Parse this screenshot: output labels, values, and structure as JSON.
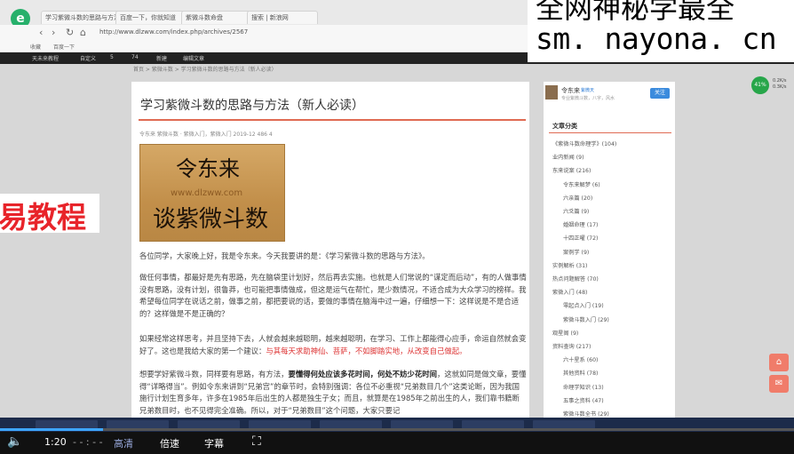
{
  "browser": {
    "tabs": [
      "学习紫微斗数的思路与方法（新人必读）",
      "百度一下，你就知道",
      "紫微斗数命盘",
      "搜索 | 新浪网"
    ],
    "url": "http://www.dlzww.com/index.php/archives/2567",
    "bookmarks": [
      "收藏",
      "百度一下"
    ],
    "nav": {
      "back": "‹",
      "forward": "›",
      "reload": "↻",
      "home": "⌂"
    }
  },
  "adminbar": {
    "items": [
      "天未来教程",
      "自定义",
      "5",
      "74",
      "新建",
      "编辑文章"
    ]
  },
  "watermark": {
    "text": "sm. nayona. cn",
    "top_text": "全网神秘学最全"
  },
  "left_overlay": {
    "text": "易教程"
  },
  "breadcrumb": "首页 > 紫微斗数 > 学习紫微斗数的思路与方法（新人必读）",
  "article": {
    "title": "学习紫微斗数的思路与方法（新人必读）",
    "meta": "令东来   紫微斗数 · 紫微入门，紫微入门   2019-12   486   4",
    "hero": {
      "line1": "令东来",
      "url": "www.dlzww.com",
      "line2": "谈紫微斗数"
    },
    "p1": "各位同学，大家晚上好，我是令东来。今天我要讲的是：《学习紫微斗数的思路与方法》。",
    "p2": "做任何事情，都最好是先有思路，先在脑袋里计划好，然后再去实施。也就是人们常说的“谋定而后动”，有的人做事情没有思路，没有计划，很鲁莽，也可能把事情做成，但这是运气在帮忙，是少数情况，不适合成为大众学习的榜样。我希望每位同学在说话之前，做事之前，都把要说的话，要做的事情在脑海中过一遍，仔细想一下：这样说是不是合适的？这样做是不是正确的？",
    "p3_a": "如果经常这样思考，并且坚持下去，人就会越来越聪明，越来越聪明，在学习、工作上都能得心应手，命运自然就会变好了。这也是我给大家的第一个建议：",
    "p3_red": "与其每天求助神仙、菩萨，不如脚踏实地，从改变自己做起。",
    "p4_a": "想要学好紫微斗数，同样要有思路，有方法，",
    "p4_bold": "要懂得何处应该多花时间，何处不妨少花时间",
    "p4_b": "，这就如同是做文章，要懂得“详略得当”。例如令东来讲到“兄弟宫”的章节时，会特别强调：各位不必重视“兄弟数目几个”这类论断，因为我国施行计划生育多年，许多在1985年后出生的人都是独生子女；而且，就算是在1985年之前出生的人，我们靠书籍断兄弟数目时，也不见得完全准确。所以，对于“兄弟数目”这个问题，大家只要记"
  },
  "sidebar": {
    "author": {
      "name": "令东来",
      "tag": "紫微天",
      "desc": "专业紫微斗数，八字，风水"
    },
    "follow_label": "关注",
    "categories_title": "文章分类",
    "categories": [
      {
        "label": "《紫微斗数命理学》(104)",
        "level": 0
      },
      {
        "label": "业内新闻 (9)",
        "level": 0
      },
      {
        "label": "东来说案 (216)",
        "level": 0
      },
      {
        "label": "令东来解梦 (6)",
        "level": 1
      },
      {
        "label": "六亲篇 (20)",
        "level": 1
      },
      {
        "label": "六爻篇 (9)",
        "level": 1
      },
      {
        "label": "婚姻命理 (17)",
        "level": 1
      },
      {
        "label": "十四正曜 (72)",
        "level": 1
      },
      {
        "label": "案例学 (9)",
        "level": 1
      },
      {
        "label": "实例解析 (31)",
        "level": 0
      },
      {
        "label": "热点问题解答 (70)",
        "level": 0
      },
      {
        "label": "紫微入门 (48)",
        "level": 0
      },
      {
        "label": "零起点入门 (19)",
        "level": 1
      },
      {
        "label": "紫微斗数入门 (29)",
        "level": 1
      },
      {
        "label": "观星阁 (9)",
        "level": 0
      },
      {
        "label": "资料查询 (217)",
        "level": 0
      },
      {
        "label": "六十星系 (60)",
        "level": 1
      },
      {
        "label": "其他资料 (78)",
        "level": 1
      },
      {
        "label": "命理学知识 (13)",
        "level": 1
      },
      {
        "label": "五事之资料 (47)",
        "level": 1
      },
      {
        "label": "紫微斗数全书 (29)",
        "level": 1
      }
    ]
  },
  "widgets": {
    "speed_percent": "41%",
    "speed_up": "0.2K/s",
    "speed_down": "0.3K/s",
    "home_icon": "⌂",
    "chat_icon": "✉"
  },
  "player": {
    "time": "1:20",
    "duration": "- - : - -",
    "quality": "高清",
    "speed": "倍速",
    "subtitle": "字幕",
    "progress": 0.13
  },
  "colors": {
    "accent": "#e06b53",
    "red_text": "#dd3333",
    "player_accent": "#3ea6ff"
  }
}
